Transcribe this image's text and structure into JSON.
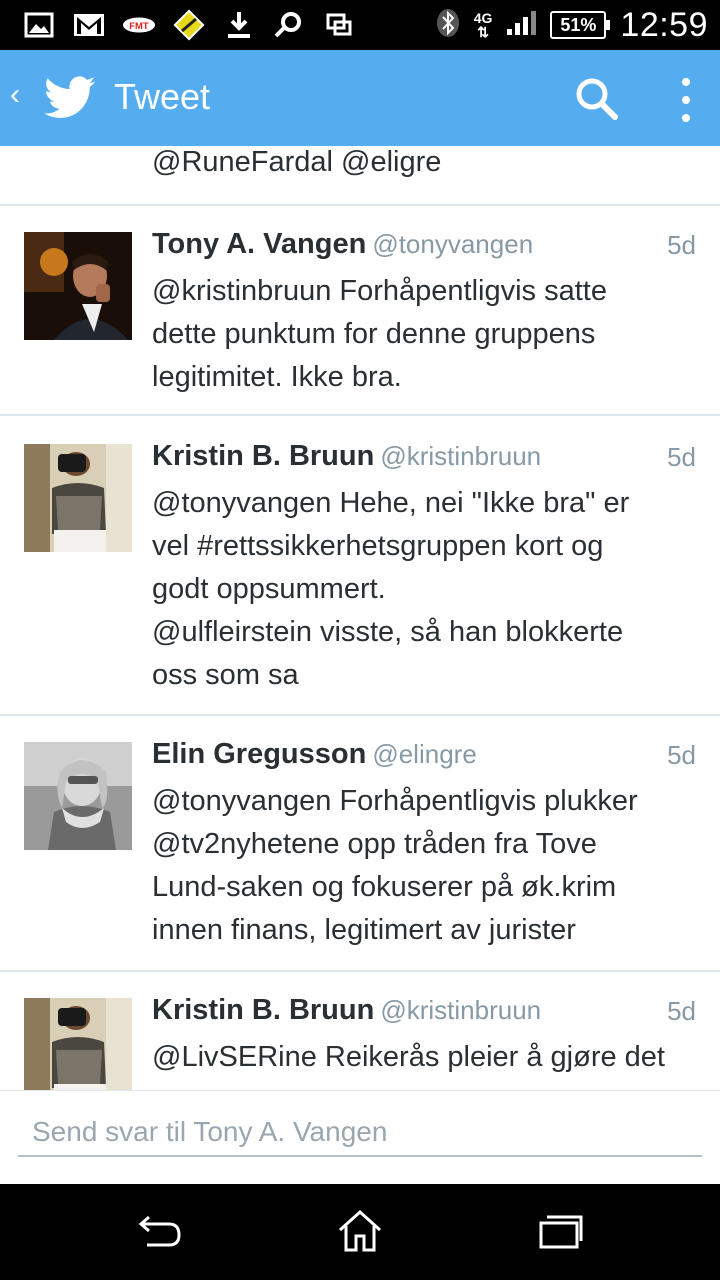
{
  "status_bar": {
    "time": "12:59",
    "battery": "51%",
    "network": "4G",
    "icons": [
      "image-icon",
      "gmail-icon",
      "fmt-icon",
      "app-icon",
      "download-icon",
      "gear-icon",
      "screen-icon",
      "bluetooth-icon",
      "signal-icon",
      "battery-icon"
    ]
  },
  "app_bar": {
    "title": "Tweet",
    "back_icon": "chevron-left-icon",
    "logo": "twitter-bird-icon",
    "actions": [
      "search-icon",
      "overflow-menu-icon"
    ],
    "accent_color": "#55acee"
  },
  "feed": {
    "partial_text": "@RuneFardal @eligre",
    "tweets": [
      {
        "name": "Tony A. Vangen",
        "handle": "@tonyvangen",
        "time": "5d",
        "lines": [
          "@kristinbruun Forhåpentligvis satte",
          "dette punktum for denne gruppens",
          "legitimitet. Ikke bra."
        ]
      },
      {
        "name": "Kristin B. Bruun",
        "handle": "@kristinbruun",
        "time": "5d",
        "lines": [
          "@tonyvangen Hehe, nei \"Ikke bra\" er",
          "vel #rettssikkerhetsgruppen kort  og",
          "godt oppsummert.",
          "@ulfleirstein visste, så han  blokkerte",
          "oss som sa"
        ]
      },
      {
        "name": "Elin Gregusson",
        "handle": "@elingre",
        "time": "5d",
        "lines": [
          "@tonyvangen Forhåpentligvis plukker",
          "@tv2nyhetene opp tråden fra Tove",
          "Lund-saken og fokuserer på øk.krim",
          "innen finans, legitimert av jurister"
        ]
      },
      {
        "name": "Kristin B. Bruun",
        "handle": "@kristinbruun",
        "time": "5d",
        "lines": [
          "@LivSERine Reikerås pleier å gjøre det"
        ]
      }
    ]
  },
  "reply": {
    "placeholder": "Send svar til Tony A. Vangen"
  },
  "nav": {
    "buttons": [
      "back-icon",
      "home-icon",
      "recents-icon"
    ]
  }
}
